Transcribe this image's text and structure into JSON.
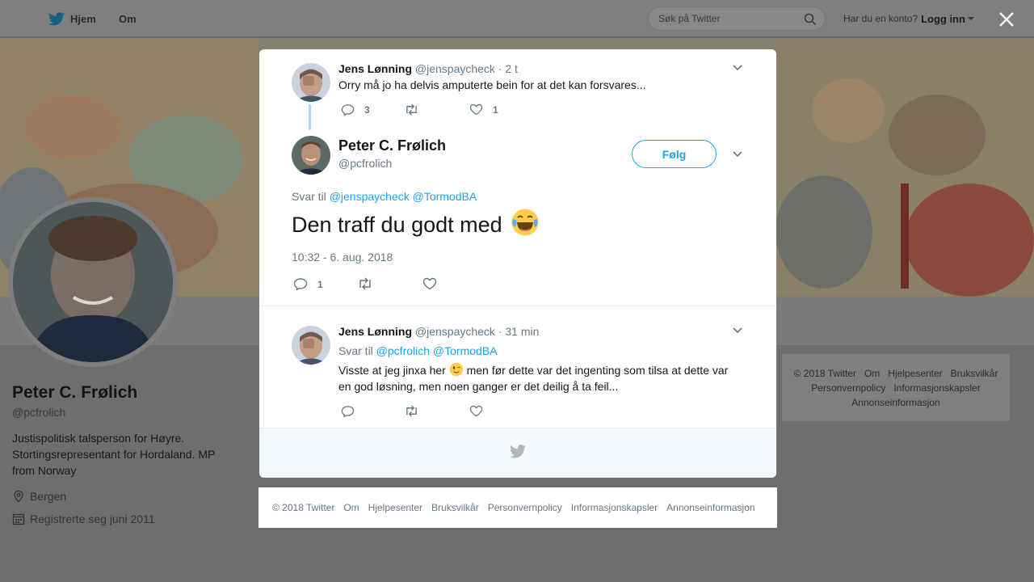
{
  "topbar": {
    "home_label": "Hjem",
    "about_label": "Om",
    "search_placeholder": "Søk på Twitter",
    "login_prompt": "Har du en konto?",
    "login_link": "Logg inn"
  },
  "profile": {
    "name": "Peter C. Frølich",
    "handle": "@pcfrolich",
    "bio": "Justispolitisk talsperson for Høyre. Stortingsrepresentant for Hordaland. MP from Norway",
    "location": "Bergen",
    "joined": "Registrerte seg juni 2011"
  },
  "right_footer": {
    "items": [
      "© 2018 Twitter",
      "Om",
      "Hjelpesenter",
      "Bruksvilkår",
      "Personvernpolicy",
      "Informasjonskapsler",
      "Annonseinformasjon"
    ]
  },
  "modal": {
    "parent_tweet": {
      "name": "Jens Lønning",
      "handle": "@jenspaycheck",
      "time": "· 2 t",
      "text": "Orry må jo ha delvis amputerte bein for at det kan forsvares...",
      "reply_count": "3",
      "like_count": "1"
    },
    "main_tweet": {
      "name": "Peter C. Frølich",
      "handle": "@pcfrolich",
      "follow_label": "Følg",
      "reply_prefix": "Svar til",
      "reply_to_1": "@jenspaycheck",
      "reply_to_2": "@TormodBA",
      "text": "Den traff du godt med",
      "emoji": "😂",
      "timestamp": "10:32 - 6. aug. 2018",
      "reply_count": "1"
    },
    "reply_tweet": {
      "name": "Jens Lønning",
      "handle": "@jenspaycheck",
      "time": "· 31 min",
      "reply_prefix": "Svar til",
      "reply_to_1": "@pcfrolich",
      "reply_to_2": "@TormodBA",
      "text_before": "Visste at jeg jinxa her",
      "emoji": "😉",
      "text_after": "men før dette var det ingenting som tilsa at dette var en god løsning, men noen ganger er det deilig å ta feil..."
    }
  },
  "footer": {
    "items": [
      "© 2018 Twitter",
      "Om",
      "Hjelpesenter",
      "Bruksvilkår",
      "Personvernpolicy",
      "Informasjonskapsler",
      "Annonseinformasjon"
    ]
  },
  "colors": {
    "accent": "#1da1f2",
    "secondary_text": "#657786",
    "overlay": "#6e6e6e"
  },
  "icons": {
    "close": "close-icon",
    "bird": "twitter-bird-icon",
    "search": "search-icon"
  }
}
